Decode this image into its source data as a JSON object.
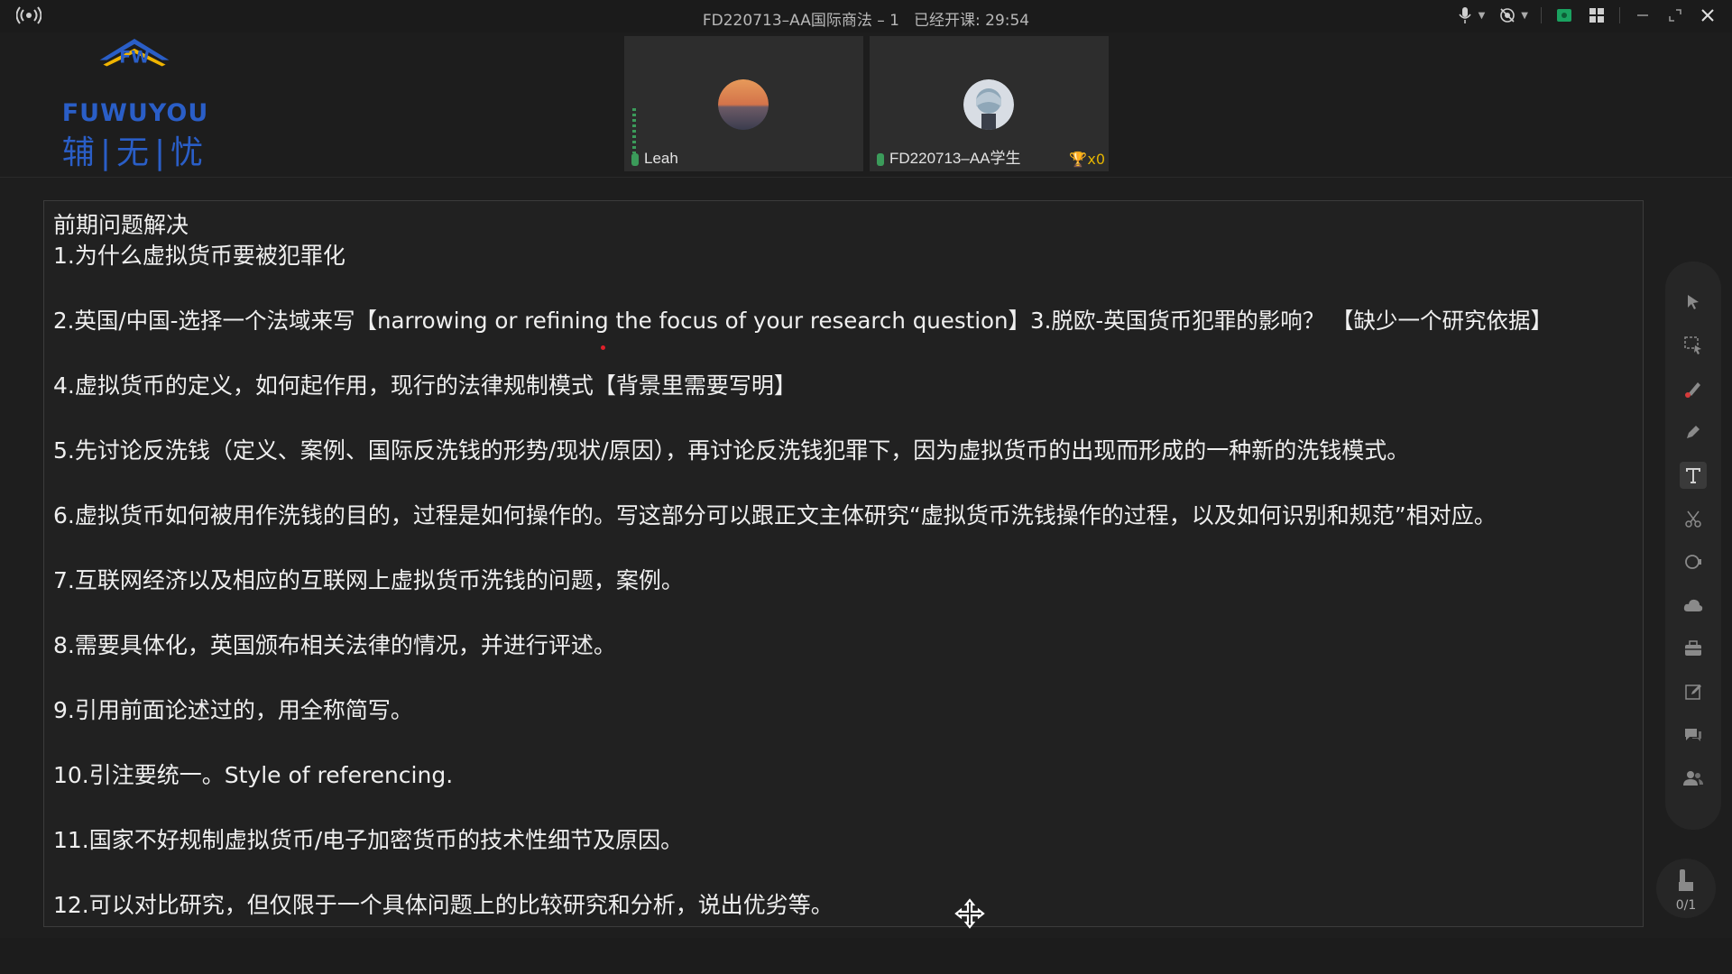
{
  "window": {
    "title": "FD220713–AA国际商法 – 1",
    "elapsed_label": "已经开课: 29:54"
  },
  "logo": {
    "brand": "FUWUYOU",
    "cn": "辅|无|忧"
  },
  "participants": [
    {
      "name": "Leah",
      "icon": "avatar-sunset"
    },
    {
      "name": "FD220713–AA学生",
      "icon": "avatar-anime",
      "trophy_count": "x0"
    }
  ],
  "document": {
    "heading": "前期问题解决",
    "items": [
      "1.为什么虚拟货币要被犯罪化",
      "2.英国/中国-选择一个法域来写【narrowing or refining the focus of your research question】3.脱欧-英国货币犯罪的影响？ 【缺少一个研究依据】",
      "4.虚拟货币的定义，如何起作用，现行的法律规制模式【背景里需要写明】",
      "5.先讨论反洗钱（定义、案例、国际反洗钱的形势/现状/原因），再讨论反洗钱犯罪下，因为虚拟货币的出现而形成的一种新的洗钱模式。",
      "6.虚拟货币如何被用作洗钱的目的，过程是如何操作的。写这部分可以跟正文主体研究“虚拟货币洗钱操作的过程，以及如何识别和规范”相对应。",
      "7.互联网经济以及相应的互联网上虚拟货币洗钱的问题，案例。",
      "8.需要具体化，英国颁布相关法律的情况，并进行评述。",
      "9.引用前面论述过的，用全称简写。",
      "10.引注要统一。Style of referencing.",
      "11.国家不好规制虚拟货币/电子加密货币的技术性细节及原因。",
      "12.可以对比研究，但仅限于一个具体问题上的比较研究和分析，说出优劣等。"
    ]
  },
  "pager": {
    "text": "0/1"
  },
  "colors": {
    "background": "#1e1e1e",
    "logo_blue": "#2a5ec7",
    "logo_yellow": "#f0b400",
    "mic_green": "#3b9b5a",
    "trophy": "#e4b400"
  }
}
